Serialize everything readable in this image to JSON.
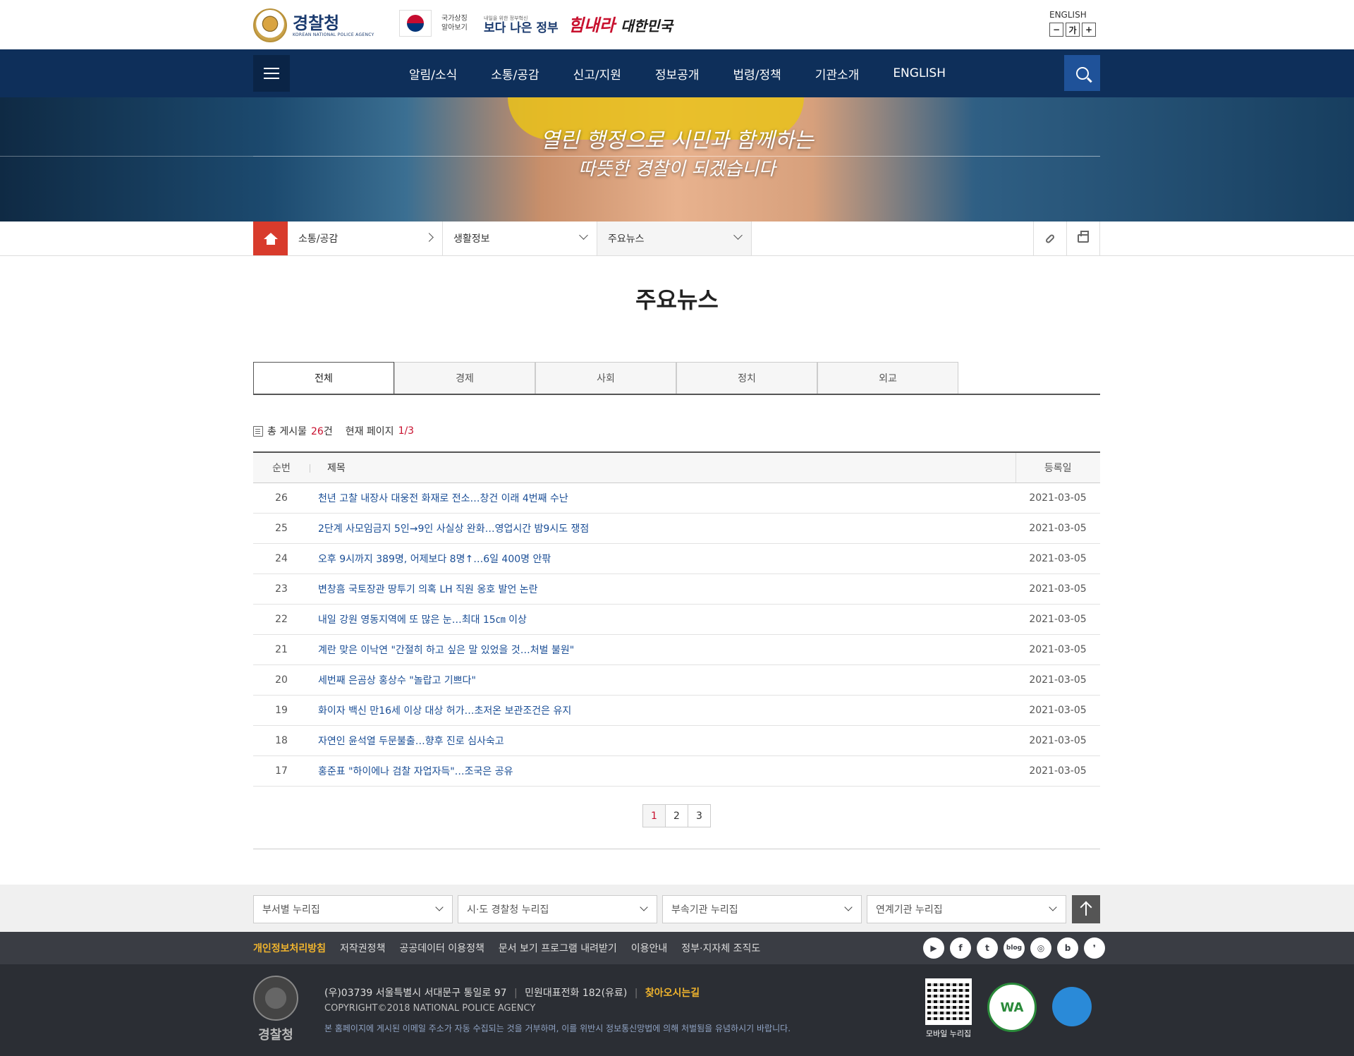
{
  "header": {
    "logo_text": "경찰청",
    "logo_sub": "KOREAN NATIONAL POLICE AGENCY",
    "symbol_text": "국가상징 알아보기",
    "gov_small": "내일을 위한 정부혁신",
    "gov_main": "보다 나은 정부",
    "slogan_red": "힘내라",
    "slogan_black": "대한민국",
    "english_link": "ENGLISH",
    "font_minus": "−",
    "font_normal": "가",
    "font_plus": "+"
  },
  "gnb": {
    "items": [
      "알림/소식",
      "소통/공감",
      "신고/지원",
      "정보공개",
      "법령/정책",
      "기관소개",
      "ENGLISH"
    ]
  },
  "visual": {
    "line1": "열린 행정으로 시민과 함께하는",
    "line2": "따뜻한 경찰이 되겠습니다"
  },
  "location": {
    "level1": "소통/공감",
    "level2": "생활정보",
    "level3": "주요뉴스"
  },
  "page": {
    "title": "주요뉴스"
  },
  "tabs": [
    "전체",
    "경제",
    "사회",
    "정치",
    "외교"
  ],
  "count": {
    "total_label": "총 게시물",
    "total": "26",
    "total_unit": "건",
    "page_label": "현재 페이지",
    "page": "1/3"
  },
  "table": {
    "headers": {
      "no": "순번",
      "subject": "제목",
      "date": "등록일"
    },
    "rows": [
      {
        "no": "26",
        "subject": "천년 고찰 내장사 대웅전 화재로 전소…창건 이래 4번째 수난",
        "date": "2021-03-05"
      },
      {
        "no": "25",
        "subject": "2단계 사모임금지 5인→9인 사실상 완화…영업시간 밤9시도 쟁점",
        "date": "2021-03-05"
      },
      {
        "no": "24",
        "subject": "오후 9시까지 389명, 어제보다 8명↑…6일 400명 안팎",
        "date": "2021-03-05"
      },
      {
        "no": "23",
        "subject": "변창흠 국토장관 땅투기 의혹 LH 직원 옹호 발언 논란",
        "date": "2021-03-05"
      },
      {
        "no": "22",
        "subject": "내일 강원 영동지역에 또 많은 눈…최대 15㎝ 이상",
        "date": "2021-03-05"
      },
      {
        "no": "21",
        "subject": "계란 맞은 이낙연 \"간절히 하고 싶은 말 있었을 것…처벌 불원\"",
        "date": "2021-03-05"
      },
      {
        "no": "20",
        "subject": "세번째 은곰상 홍상수 \"놀랍고 기쁘다\"",
        "date": "2021-03-05"
      },
      {
        "no": "19",
        "subject": "화이자 백신 만16세 이상 대상 허가…초저온 보관조건은 유지",
        "date": "2021-03-05"
      },
      {
        "no": "18",
        "subject": "자연인 윤석열 두문불출…향후 진로 심사숙고",
        "date": "2021-03-05"
      },
      {
        "no": "17",
        "subject": "홍준표 \"하이에나 검찰 자업자득\"…조국은 공유",
        "date": "2021-03-05"
      }
    ]
  },
  "paging": [
    "1",
    "2",
    "3"
  ],
  "footer_selects": [
    "부서별 누리집",
    "시·도 경찰청 누리집",
    "부속기관 누리집",
    "연계기관 누리집"
  ],
  "footer_links": [
    "개인정보처리방침",
    "저작권정책",
    "공공데이터 이용정책",
    "문서 보기 프로그램 내려받기",
    "이용안내",
    "정부·지자체 조직도"
  ],
  "sns": [
    "▶",
    "f",
    "t",
    "blog",
    "◎",
    "b",
    "❜"
  ],
  "footer": {
    "logo_text": "경찰청",
    "address": "(우)03739 서울특별시 서대문구 통일로 97",
    "phone": "민원대표전화 182(유료)",
    "directions": "찾아오시는길",
    "copyright": "COPYRIGHT©2018 NATIONAL POLICE AGENCY",
    "warning": "본 홈페이지에 게시된 이메일 주소가 자동 수집되는 것을 거부하며, 이를 위반시 정보통신망법에 의해 처벌됨을 유념하시기 바랍니다.",
    "qr_label": "모바일 누리집",
    "wa_mark": "WA"
  }
}
